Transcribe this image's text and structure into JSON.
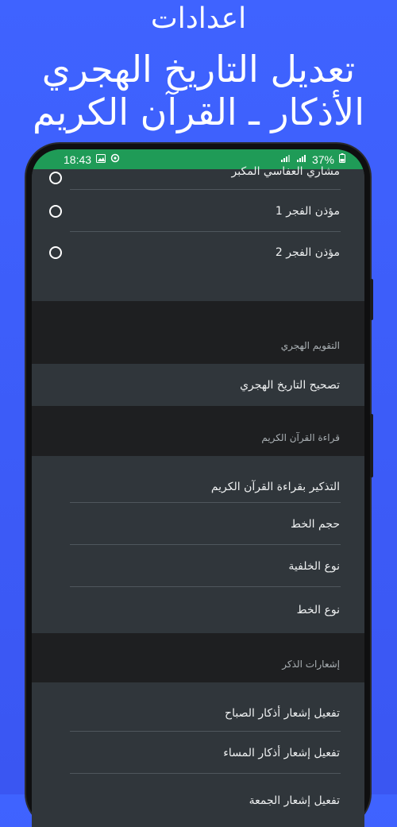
{
  "promo": {
    "line1": "اعدادات",
    "line2": "تعديل التاريخ الهجري",
    "line3": "الأذكار ـ القرآن الكريم"
  },
  "status_bar": {
    "time": "18:43",
    "battery": "37%",
    "icons": [
      "image-icon",
      "settings-gear-icon",
      "wifi-icon",
      "signal-icon",
      "battery-icon"
    ]
  },
  "muezzin_list": [
    {
      "label": "مشاري العفاسي المكبر"
    },
    {
      "label": "مؤذن الفجر 1"
    },
    {
      "label": "مؤذن الفجر 2"
    }
  ],
  "sections": {
    "hijri_calendar": {
      "title": "التقويم الهجري",
      "items": [
        "تصحيح التاريخ الهجري"
      ]
    },
    "quran_reading": {
      "title": "قراءة القرآن الكريم",
      "items": [
        "التذكير بقراءة القرآن الكريم",
        "حجم الخط",
        "نوع الخلفية",
        "نوع الخط"
      ]
    },
    "dhikr_notifications": {
      "title": "إشعارات الذكر",
      "items": [
        "تفعيل إشعار أذكار الصباح",
        "تفعيل إشعار أذكار المساء",
        "تفعيل إشعار الجمعة"
      ]
    }
  },
  "colors": {
    "background_blue": "#3f63ff",
    "status_green": "#1f9b57",
    "row_bg": "#30363b",
    "section_bg": "#1e1f21"
  }
}
